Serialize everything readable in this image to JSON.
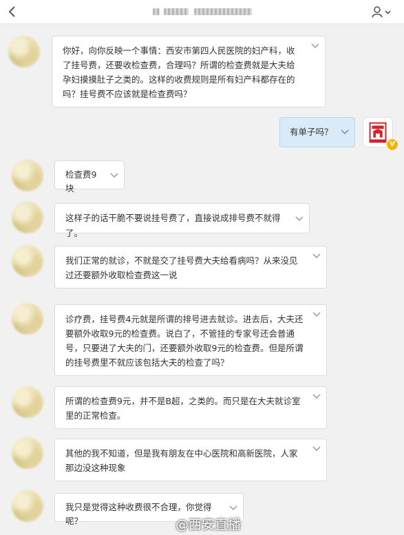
{
  "header": {
    "title": "",
    "icons": {
      "back": "back-arrow-icon",
      "settings": "user-settings-icon"
    }
  },
  "messages": [
    {
      "side": "left",
      "text": "你好，向你反映一个事情：西安市第四人民医院的妇产科，收了挂号费，还要收检查费，合理吗？所谓的检查费就是大夫给孕妇摸摸肚子之类的。这样的收费规则是所有妇产科都存在的吗？挂号费不应该就是检查费吗？"
    },
    {
      "side": "right",
      "text": "有单子吗？"
    },
    {
      "side": "left",
      "text": "检查费9块"
    },
    {
      "side": "left",
      "text": "这样子的话干脆不要说挂号费了，直接说成排号费不就得了。"
    },
    {
      "side": "left",
      "text": "我们正常的就诊，不就是交了挂号费大夫给看病吗？从来没见过还要额外收取检查费这一说"
    },
    {
      "side": "left",
      "text": "诊疗费，挂号费4元就是所谓的排号进去就诊。进去后，大夫还要额外收取9元的检查费。说白了，不管挂的专家号还会普通号，只要进了大夫的门，还要额外收取9元的检查费。但是所谓的挂号费里不就应该包括大夫的检查了吗？"
    },
    {
      "side": "left",
      "text": "所谓的检查费9元，并不是B超，之类的。而只是在大夫就诊室里的正常检查。"
    },
    {
      "side": "left",
      "text": "其他的我不知道，但是我有朋友在中心医院和高新医院，人家那边没这种现象"
    },
    {
      "side": "left",
      "text": "我只是觉得这种收费很不合理，你觉得呢？"
    }
  ],
  "verified_badge": "V",
  "watermark": "@西安直播",
  "colors": {
    "background": "#f1f1f1",
    "bubble_left": "#ffffff",
    "bubble_right": "#d9ebf8",
    "avatar_brand_red": "#d6202a",
    "badge": "#f4b400"
  }
}
